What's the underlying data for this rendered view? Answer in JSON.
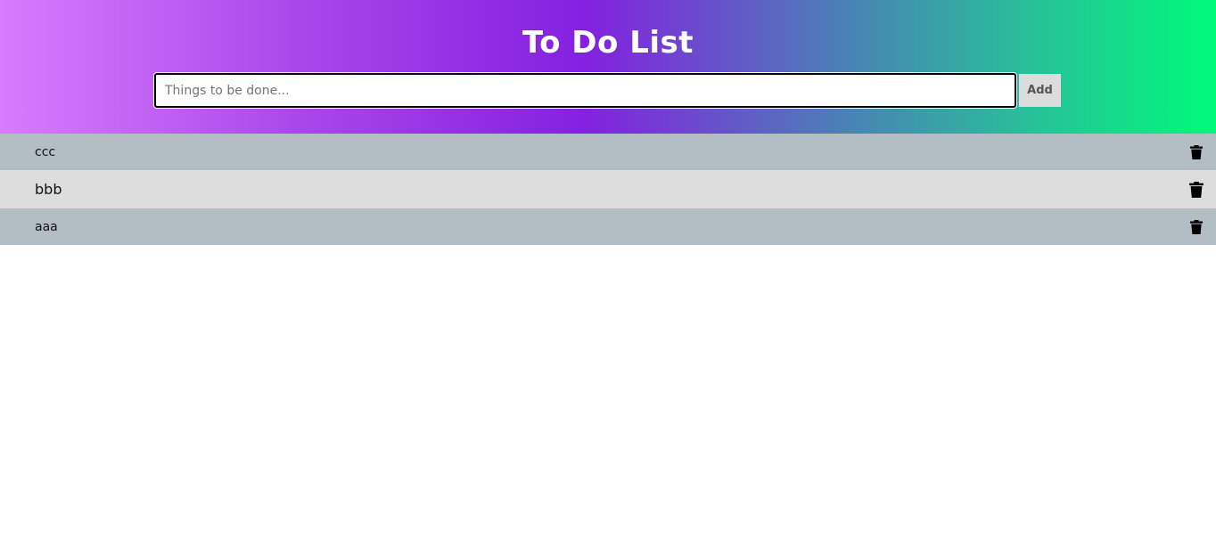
{
  "header": {
    "title": "To Do List",
    "input_placeholder": "Things to be done...",
    "input_value": "",
    "add_label": "Add"
  },
  "colors": {
    "gradient_start": "#d97bff",
    "gradient_mid": "#8420e0",
    "gradient_end": "#00fa7a",
    "row_odd": "#b2bdc4",
    "row_even": "#dddddd"
  },
  "todos": [
    {
      "text": "ccc",
      "icon": "trash-icon"
    },
    {
      "text": "bbb",
      "icon": "trash-icon"
    },
    {
      "text": "aaa",
      "icon": "trash-icon"
    }
  ]
}
